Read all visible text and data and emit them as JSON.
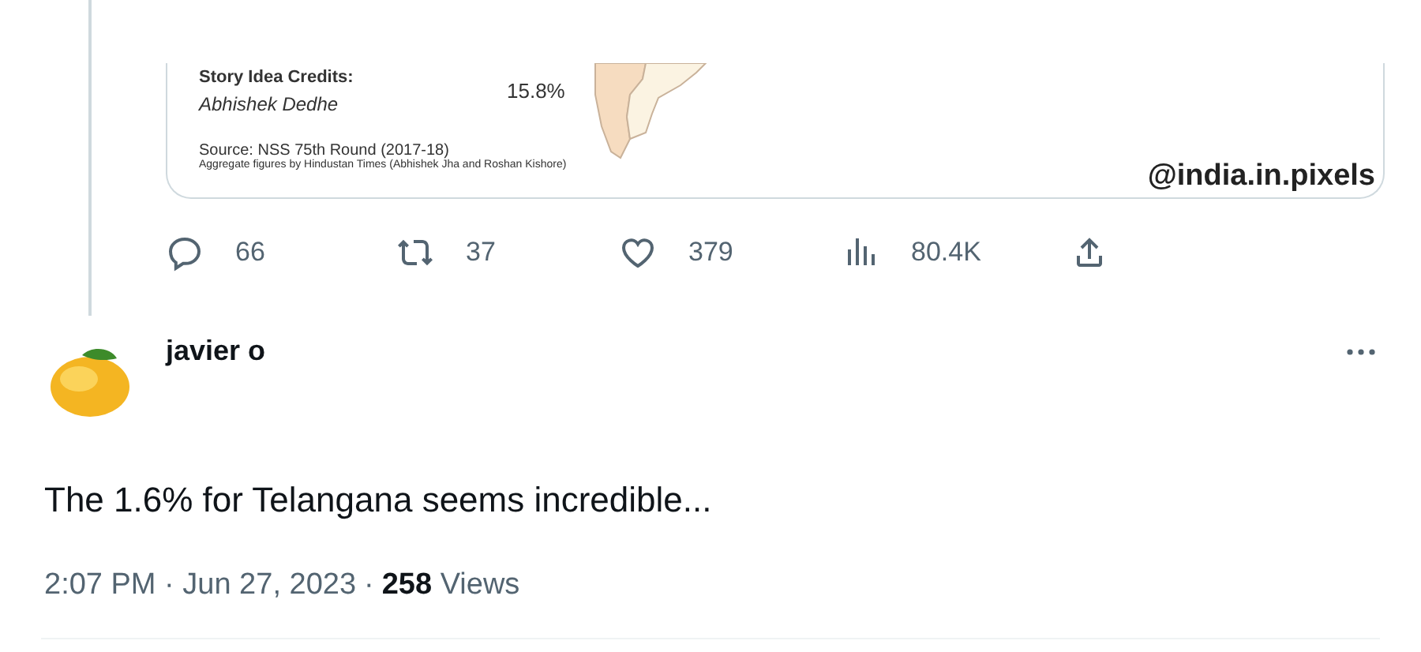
{
  "embedded_image": {
    "credits_label": "Story Idea Credits:",
    "credits_name": "Abhishek Dedhe",
    "map_value": "15.8%",
    "source": "Source: NSS 75th Round (2017-18)",
    "note": "Aggregate figures by Hindustan Times (Abhishek Jha and Roshan Kishore)",
    "handle": "@india.in.pixels"
  },
  "actions": [
    {
      "kind": "reply",
      "count": "66"
    },
    {
      "kind": "repost",
      "count": "37"
    },
    {
      "kind": "like",
      "count": "379"
    },
    {
      "kind": "views",
      "count": "80.4K"
    },
    {
      "kind": "share"
    }
  ],
  "reply": {
    "author": "javier o",
    "text": "The 1.6% for Telangana seems incredible...",
    "time": "2:07 PM · Jun 27, 2023",
    "separator": "·",
    "views_count": "258",
    "views_label": "Views"
  }
}
